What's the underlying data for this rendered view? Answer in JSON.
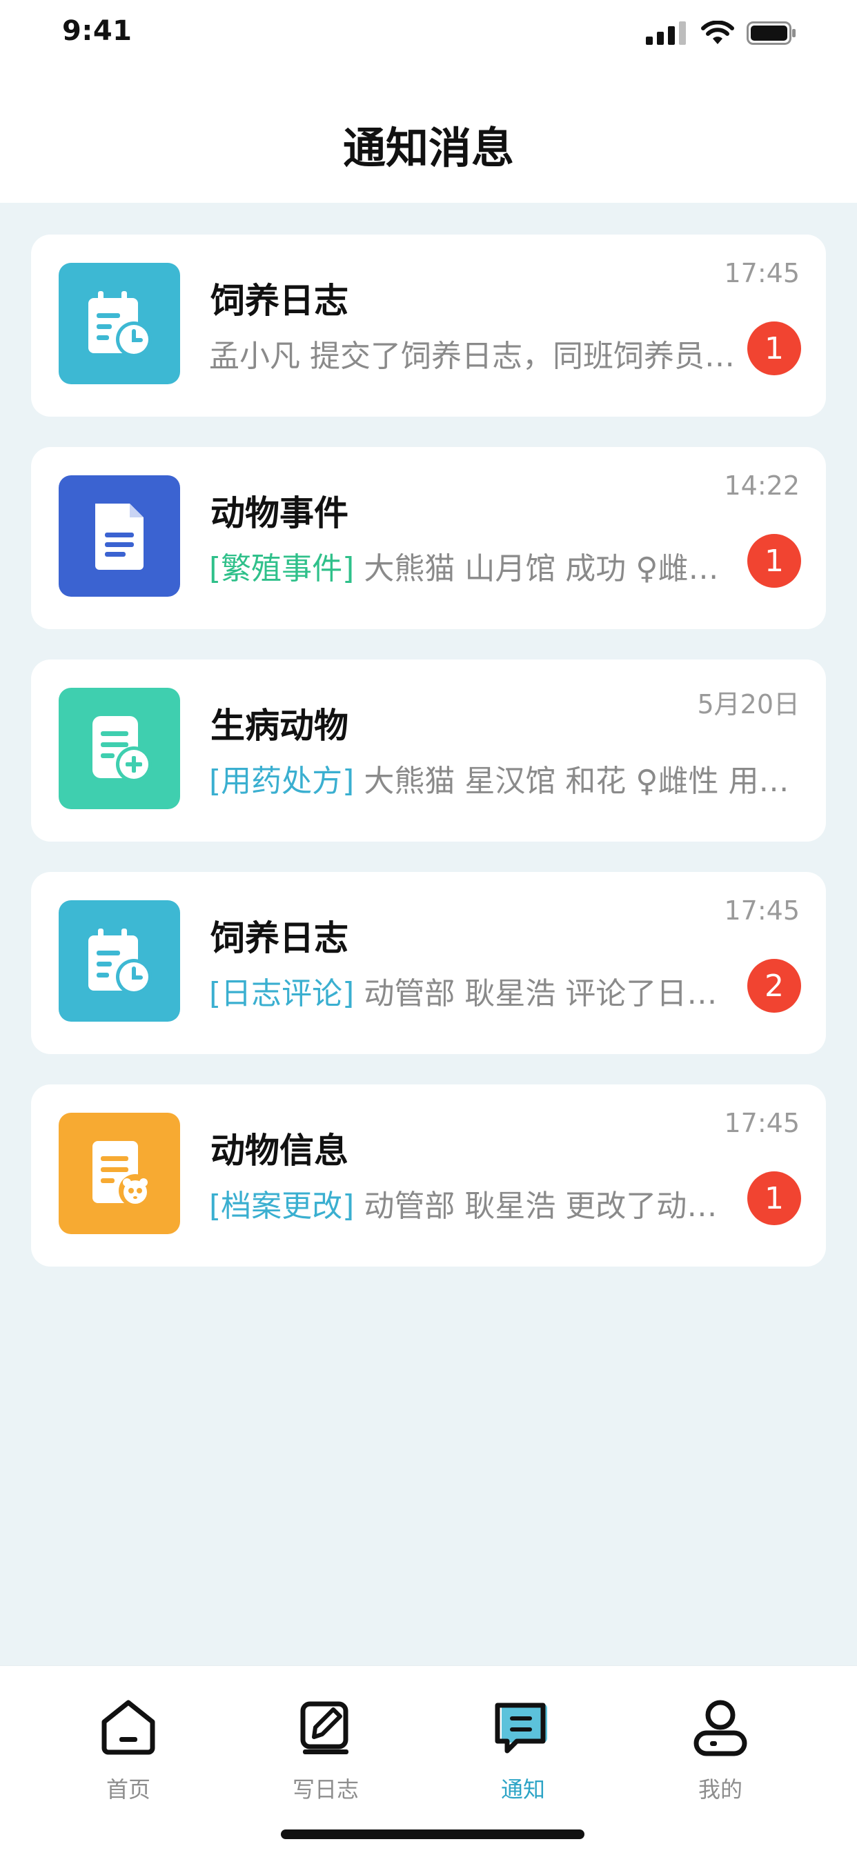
{
  "status_bar": {
    "time": "9:41"
  },
  "page": {
    "title": "通知消息"
  },
  "notifications": [
    {
      "icon": "calendar-clock-icon",
      "icon_bg": "#3DB8D3",
      "title": "饲养日志",
      "time": "17:45",
      "tag": "",
      "preview": "孟小凡 提交了饲养日志，同班饲养员请查看",
      "badge": "1"
    },
    {
      "icon": "document-icon",
      "icon_bg": "#3B63D1",
      "title": "动物事件",
      "time": "14:22",
      "tag": "[繁殖事件]",
      "tag_color": "#2FC08A",
      "preview": " 大熊猫 山月馆 成功 ♀雌性幼崽",
      "badge": "1"
    },
    {
      "icon": "prescription-icon",
      "icon_bg": "#3FCFAF",
      "title": "生病动物",
      "time": "5月20日",
      "tag": "[用药处方]",
      "tag_color": "#3AAFD0",
      "preview": " 大熊猫 星汉馆 和花 ♀雌性 用药处方",
      "badge": ""
    },
    {
      "icon": "calendar-clock-icon",
      "icon_bg": "#3DB8D3",
      "title": "饲养日志",
      "time": "17:45",
      "tag": "[日志评论]",
      "tag_color": "#3AAFD0",
      "preview": " 动管部 耿星浩 评论了日志内容",
      "badge": "2"
    },
    {
      "icon": "animal-file-icon",
      "icon_bg": "#F7AA32",
      "title": "动物信息",
      "time": "17:45",
      "tag": "[档案更改]",
      "tag_color": "#3AAFD0",
      "preview": " 动管部 耿星浩 更改了动物档案信息",
      "badge": "1"
    }
  ],
  "tabbar": {
    "items": [
      {
        "label": "首页",
        "icon": "home-icon",
        "active": false
      },
      {
        "label": "写日志",
        "icon": "edit-icon",
        "active": false
      },
      {
        "label": "通知",
        "icon": "message-icon",
        "active": true
      },
      {
        "label": "我的",
        "icon": "user-icon",
        "active": false
      }
    ],
    "active_color": "#2CA4C6"
  }
}
